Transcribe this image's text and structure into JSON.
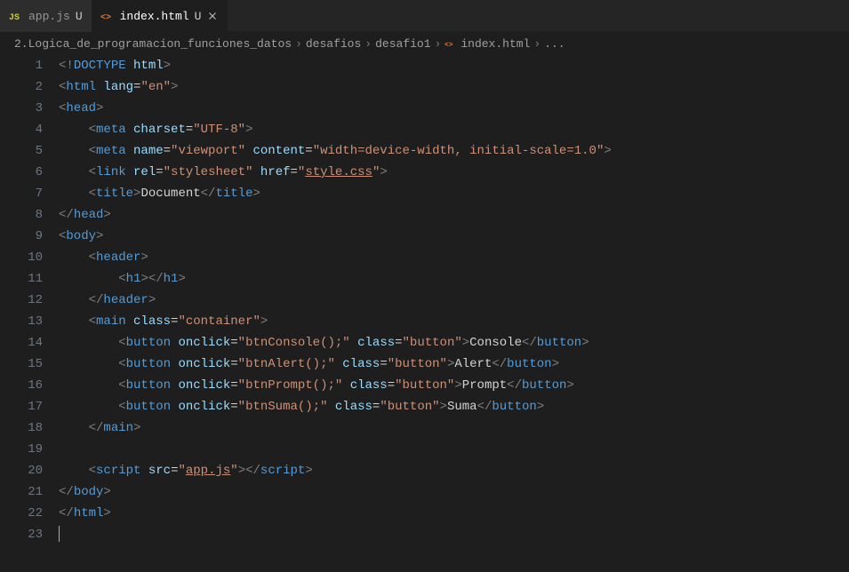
{
  "tabs": [
    {
      "label": "app.js",
      "modified": "U",
      "active": false,
      "iconColor": "#cbcb41"
    },
    {
      "label": "index.html",
      "modified": "U",
      "active": true,
      "iconColor": "#e37933"
    }
  ],
  "breadcrumbs": {
    "parts": [
      "2.Logica_de_programacion_funciones_datos",
      "desafios",
      "desafio1",
      "index.html",
      "..."
    ],
    "sep": "›"
  },
  "lines": [
    {
      "n": "1",
      "indent": 0,
      "tokens": [
        {
          "t": "<!",
          "c": "c-gray"
        },
        {
          "t": "DOCTYPE",
          "c": "c-tag"
        },
        {
          "t": " ",
          "c": "c-gray"
        },
        {
          "t": "html",
          "c": "c-attr"
        },
        {
          "t": ">",
          "c": "c-gray"
        }
      ]
    },
    {
      "n": "2",
      "indent": 0,
      "tokens": [
        {
          "t": "<",
          "c": "c-gray"
        },
        {
          "t": "html",
          "c": "c-tag"
        },
        {
          "t": " ",
          "c": ""
        },
        {
          "t": "lang",
          "c": "c-attr"
        },
        {
          "t": "=",
          "c": "c-punc"
        },
        {
          "t": "\"en\"",
          "c": "c-str"
        },
        {
          "t": ">",
          "c": "c-gray"
        }
      ]
    },
    {
      "n": "3",
      "indent": 0,
      "tokens": [
        {
          "t": "<",
          "c": "c-gray"
        },
        {
          "t": "head",
          "c": "c-tag"
        },
        {
          "t": ">",
          "c": "c-gray"
        }
      ]
    },
    {
      "n": "4",
      "indent": 1,
      "tokens": [
        {
          "t": "<",
          "c": "c-gray"
        },
        {
          "t": "meta",
          "c": "c-tag"
        },
        {
          "t": " ",
          "c": ""
        },
        {
          "t": "charset",
          "c": "c-attr"
        },
        {
          "t": "=",
          "c": "c-punc"
        },
        {
          "t": "\"UTF-8\"",
          "c": "c-str"
        },
        {
          "t": ">",
          "c": "c-gray"
        }
      ]
    },
    {
      "n": "5",
      "indent": 1,
      "tokens": [
        {
          "t": "<",
          "c": "c-gray"
        },
        {
          "t": "meta",
          "c": "c-tag"
        },
        {
          "t": " ",
          "c": ""
        },
        {
          "t": "name",
          "c": "c-attr"
        },
        {
          "t": "=",
          "c": "c-punc"
        },
        {
          "t": "\"viewport\"",
          "c": "c-str"
        },
        {
          "t": " ",
          "c": ""
        },
        {
          "t": "content",
          "c": "c-attr"
        },
        {
          "t": "=",
          "c": "c-punc"
        },
        {
          "t": "\"width=device-width, initial-scale=1.0\"",
          "c": "c-str"
        },
        {
          "t": ">",
          "c": "c-gray"
        }
      ]
    },
    {
      "n": "6",
      "indent": 1,
      "tokens": [
        {
          "t": "<",
          "c": "c-gray"
        },
        {
          "t": "link",
          "c": "c-tag"
        },
        {
          "t": " ",
          "c": ""
        },
        {
          "t": "rel",
          "c": "c-attr"
        },
        {
          "t": "=",
          "c": "c-punc"
        },
        {
          "t": "\"stylesheet\"",
          "c": "c-str"
        },
        {
          "t": " ",
          "c": ""
        },
        {
          "t": "href",
          "c": "c-attr"
        },
        {
          "t": "=",
          "c": "c-punc"
        },
        {
          "t": "\"",
          "c": "c-str"
        },
        {
          "t": "style.css",
          "c": "c-str c-underline"
        },
        {
          "t": "\"",
          "c": "c-str"
        },
        {
          "t": ">",
          "c": "c-gray"
        }
      ]
    },
    {
      "n": "7",
      "indent": 1,
      "tokens": [
        {
          "t": "<",
          "c": "c-gray"
        },
        {
          "t": "title",
          "c": "c-tag"
        },
        {
          "t": ">",
          "c": "c-gray"
        },
        {
          "t": "Document",
          "c": "c-text"
        },
        {
          "t": "</",
          "c": "c-gray"
        },
        {
          "t": "title",
          "c": "c-tag"
        },
        {
          "t": ">",
          "c": "c-gray"
        }
      ]
    },
    {
      "n": "8",
      "indent": 0,
      "tokens": [
        {
          "t": "</",
          "c": "c-gray"
        },
        {
          "t": "head",
          "c": "c-tag"
        },
        {
          "t": ">",
          "c": "c-gray"
        }
      ]
    },
    {
      "n": "9",
      "indent": 0,
      "tokens": [
        {
          "t": "<",
          "c": "c-gray"
        },
        {
          "t": "body",
          "c": "c-tag"
        },
        {
          "t": ">",
          "c": "c-gray"
        }
      ]
    },
    {
      "n": "10",
      "indent": 1,
      "tokens": [
        {
          "t": "<",
          "c": "c-gray"
        },
        {
          "t": "header",
          "c": "c-tag"
        },
        {
          "t": ">",
          "c": "c-gray"
        }
      ]
    },
    {
      "n": "11",
      "indent": 2,
      "tokens": [
        {
          "t": "<",
          "c": "c-gray"
        },
        {
          "t": "h1",
          "c": "c-tag"
        },
        {
          "t": ">",
          "c": "c-gray"
        },
        {
          "t": "</",
          "c": "c-gray"
        },
        {
          "t": "h1",
          "c": "c-tag"
        },
        {
          "t": ">",
          "c": "c-gray"
        }
      ]
    },
    {
      "n": "12",
      "indent": 1,
      "tokens": [
        {
          "t": "</",
          "c": "c-gray"
        },
        {
          "t": "header",
          "c": "c-tag"
        },
        {
          "t": ">",
          "c": "c-gray"
        }
      ]
    },
    {
      "n": "13",
      "indent": 1,
      "tokens": [
        {
          "t": "<",
          "c": "c-gray"
        },
        {
          "t": "main",
          "c": "c-tag"
        },
        {
          "t": " ",
          "c": ""
        },
        {
          "t": "class",
          "c": "c-attr"
        },
        {
          "t": "=",
          "c": "c-punc"
        },
        {
          "t": "\"container\"",
          "c": "c-str"
        },
        {
          "t": ">",
          "c": "c-gray"
        }
      ]
    },
    {
      "n": "14",
      "indent": 2,
      "tokens": [
        {
          "t": "<",
          "c": "c-gray"
        },
        {
          "t": "button",
          "c": "c-tag"
        },
        {
          "t": " ",
          "c": ""
        },
        {
          "t": "onclick",
          "c": "c-attr"
        },
        {
          "t": "=",
          "c": "c-punc"
        },
        {
          "t": "\"btnConsole();\"",
          "c": "c-str"
        },
        {
          "t": " ",
          "c": ""
        },
        {
          "t": "class",
          "c": "c-attr"
        },
        {
          "t": "=",
          "c": "c-punc"
        },
        {
          "t": "\"button\"",
          "c": "c-str"
        },
        {
          "t": ">",
          "c": "c-gray"
        },
        {
          "t": "Console",
          "c": "c-text"
        },
        {
          "t": "</",
          "c": "c-gray"
        },
        {
          "t": "button",
          "c": "c-tag"
        },
        {
          "t": ">",
          "c": "c-gray"
        }
      ]
    },
    {
      "n": "15",
      "indent": 2,
      "tokens": [
        {
          "t": "<",
          "c": "c-gray"
        },
        {
          "t": "button",
          "c": "c-tag"
        },
        {
          "t": " ",
          "c": ""
        },
        {
          "t": "onclick",
          "c": "c-attr"
        },
        {
          "t": "=",
          "c": "c-punc"
        },
        {
          "t": "\"btnAlert();\"",
          "c": "c-str"
        },
        {
          "t": " ",
          "c": ""
        },
        {
          "t": "class",
          "c": "c-attr"
        },
        {
          "t": "=",
          "c": "c-punc"
        },
        {
          "t": "\"button\"",
          "c": "c-str"
        },
        {
          "t": ">",
          "c": "c-gray"
        },
        {
          "t": "Alert",
          "c": "c-text"
        },
        {
          "t": "</",
          "c": "c-gray"
        },
        {
          "t": "button",
          "c": "c-tag"
        },
        {
          "t": ">",
          "c": "c-gray"
        }
      ]
    },
    {
      "n": "16",
      "indent": 2,
      "tokens": [
        {
          "t": "<",
          "c": "c-gray"
        },
        {
          "t": "button",
          "c": "c-tag"
        },
        {
          "t": " ",
          "c": ""
        },
        {
          "t": "onclick",
          "c": "c-attr"
        },
        {
          "t": "=",
          "c": "c-punc"
        },
        {
          "t": "\"btnPrompt();\"",
          "c": "c-str"
        },
        {
          "t": " ",
          "c": ""
        },
        {
          "t": "class",
          "c": "c-attr"
        },
        {
          "t": "=",
          "c": "c-punc"
        },
        {
          "t": "\"button\"",
          "c": "c-str"
        },
        {
          "t": ">",
          "c": "c-gray"
        },
        {
          "t": "Prompt",
          "c": "c-text"
        },
        {
          "t": "</",
          "c": "c-gray"
        },
        {
          "t": "button",
          "c": "c-tag"
        },
        {
          "t": ">",
          "c": "c-gray"
        }
      ]
    },
    {
      "n": "17",
      "indent": 2,
      "tokens": [
        {
          "t": "<",
          "c": "c-gray"
        },
        {
          "t": "button",
          "c": "c-tag"
        },
        {
          "t": " ",
          "c": ""
        },
        {
          "t": "onclick",
          "c": "c-attr"
        },
        {
          "t": "=",
          "c": "c-punc"
        },
        {
          "t": "\"btnSuma();\"",
          "c": "c-str"
        },
        {
          "t": " ",
          "c": ""
        },
        {
          "t": "class",
          "c": "c-attr"
        },
        {
          "t": "=",
          "c": "c-punc"
        },
        {
          "t": "\"button\"",
          "c": "c-str"
        },
        {
          "t": ">",
          "c": "c-gray"
        },
        {
          "t": "Suma",
          "c": "c-text"
        },
        {
          "t": "</",
          "c": "c-gray"
        },
        {
          "t": "button",
          "c": "c-tag"
        },
        {
          "t": ">",
          "c": "c-gray"
        }
      ]
    },
    {
      "n": "18",
      "indent": 1,
      "tokens": [
        {
          "t": "</",
          "c": "c-gray"
        },
        {
          "t": "main",
          "c": "c-tag"
        },
        {
          "t": ">",
          "c": "c-gray"
        }
      ]
    },
    {
      "n": "19",
      "indent": 1,
      "tokens": []
    },
    {
      "n": "20",
      "indent": 1,
      "tokens": [
        {
          "t": "<",
          "c": "c-gray"
        },
        {
          "t": "script",
          "c": "c-tag"
        },
        {
          "t": " ",
          "c": ""
        },
        {
          "t": "src",
          "c": "c-attr"
        },
        {
          "t": "=",
          "c": "c-punc"
        },
        {
          "t": "\"",
          "c": "c-str"
        },
        {
          "t": "app.js",
          "c": "c-str c-underline"
        },
        {
          "t": "\"",
          "c": "c-str"
        },
        {
          "t": ">",
          "c": "c-gray"
        },
        {
          "t": "</",
          "c": "c-gray"
        },
        {
          "t": "script",
          "c": "c-tag"
        },
        {
          "t": ">",
          "c": "c-gray"
        }
      ]
    },
    {
      "n": "21",
      "indent": 0,
      "tokens": [
        {
          "t": "</",
          "c": "c-gray"
        },
        {
          "t": "body",
          "c": "c-tag"
        },
        {
          "t": ">",
          "c": "c-gray"
        }
      ]
    },
    {
      "n": "22",
      "indent": 0,
      "tokens": [
        {
          "t": "</",
          "c": "c-gray"
        },
        {
          "t": "html",
          "c": "c-tag"
        },
        {
          "t": ">",
          "c": "c-gray"
        }
      ]
    },
    {
      "n": "23",
      "indent": 0,
      "cursor": true,
      "tokens": []
    }
  ]
}
